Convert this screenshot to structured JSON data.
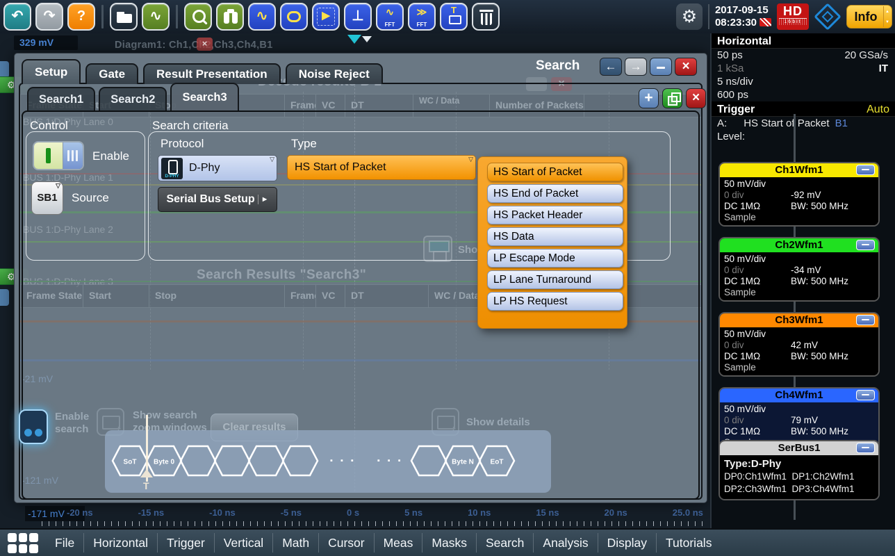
{
  "toolbar": {
    "icons": [
      {
        "name": "undo-icon",
        "cls": "c-teal",
        "glyph": "↶"
      },
      {
        "name": "redo-icon",
        "cls": "c-gray",
        "glyph": "↷"
      },
      {
        "name": "help-icon",
        "cls": "c-orange",
        "glyph": "?"
      },
      {
        "name": "toolbar-separator",
        "cls": "sep",
        "inter": false
      },
      {
        "name": "open-file-icon",
        "cls": "c-dark folder"
      },
      {
        "name": "signal-generator-icon",
        "cls": "c-green",
        "glyph": "∿"
      },
      {
        "name": "toolbar-separator",
        "cls": "sep",
        "inter": false
      },
      {
        "name": "zoom-icon",
        "cls": "c-green zoomsearch"
      },
      {
        "name": "find-binoculars-icon",
        "cls": "c-green binoculars"
      },
      {
        "name": "math-waveform-icon",
        "cls": "c-blue",
        "glyph": "∿",
        "fg": "#ffe14a"
      },
      {
        "name": "mask-test-icon",
        "cls": "c-blue masktest"
      },
      {
        "name": "reference-play-icon",
        "cls": "c-blue playmask",
        "glyph": "▶",
        "fg": "#ffe14a"
      },
      {
        "name": "measurement-caliper-icon",
        "cls": "c-blue",
        "glyph": "⊥",
        "fg": "#ffffff"
      },
      {
        "name": "fft-spectrum-icon",
        "cls": "c-blue fft",
        "glyph": "∿",
        "sub": "FFT",
        "fg": "#ffe14a"
      },
      {
        "name": "fft-gated-icon",
        "cls": "c-blue fft",
        "glyph": "≫",
        "sub": "FFT",
        "fg": "#ffe14a"
      },
      {
        "name": "timing-clamp-icon",
        "cls": "c-blue tclamp",
        "glyph": "T",
        "fg": "#ffe14a"
      },
      {
        "name": "delete-trash-icon",
        "cls": "c-dark trash"
      }
    ],
    "gear_glyph": "⚙",
    "date": "2017-09-15",
    "time": "08:23:30",
    "hd_badge": {
      "top": "HD",
      "bottom": "16bit"
    },
    "info_label": "Info"
  },
  "screen": {
    "corner_value": "329 mV",
    "diagram_tab": "Diagram1: Ch1,Ch2,Ch3,Ch4,B1",
    "close_glyph": "×",
    "tool_glyph": "⚙",
    "axis": {
      "left_label": "-171 mV",
      "ticks": [
        "-20 ns",
        "-15 ns",
        "-10 ns",
        "-5 ns",
        "0 s",
        "5 ns",
        "10 ns",
        "15 ns",
        "20 ns",
        "25.0 ns"
      ]
    }
  },
  "dialog": {
    "title": "Search",
    "window_buttons": {
      "back_glyph": "←",
      "forward_glyph": "→",
      "close_glyph": "×",
      "add_glyph": "+"
    },
    "tabs": [
      {
        "label": "Setup",
        "active": true
      },
      {
        "label": "Gate"
      },
      {
        "label": "Result Presentation"
      },
      {
        "label": "Noise Reject"
      }
    ],
    "search_tabs": [
      {
        "label": "Search1"
      },
      {
        "label": "Search2"
      },
      {
        "label": "Search3",
        "active": true
      }
    ],
    "control": {
      "heading": "Control",
      "enable_label": "Enable",
      "source_label": "Source",
      "source_value": "SB1"
    },
    "criteria": {
      "heading": "Search criteria",
      "protocol_label": "Protocol",
      "protocol_value": "D-Phy",
      "protocol_icon_text": "D-PHY",
      "serial_bus_label": "Serial Bus Setup",
      "serial_bus_arrow": "►",
      "type_label": "Type",
      "type_value": "HS Start of Packet"
    },
    "type_menu": [
      {
        "label": "HS Start of Packet",
        "active": true
      },
      {
        "label": "HS End of Packet"
      },
      {
        "label": "HS Packet Header"
      },
      {
        "label": "HS Data"
      },
      {
        "label": "LP Escape Mode"
      },
      {
        "label": "LP Lane Turnaround"
      },
      {
        "label": "LP HS Request"
      }
    ],
    "ghost": {
      "decode_title": "Decode results B 1",
      "decode_columns": [
        "Frame State",
        "Start",
        "Stop",
        "Frame Type",
        "VC",
        "DT",
        "WC / Data",
        "Number of Packets"
      ],
      "results_title": "Search Results \"Search3\"",
      "results_columns": [
        "Frame State",
        "Start",
        "Stop",
        "Frame Type",
        "VC",
        "DT",
        "WC / Data"
      ],
      "lane_labels": [
        "BUS 1:D-Phy Lane 0",
        "BUS 1:D-Phy Lane 1",
        "BUS 1:D-Phy Lane 2",
        "BUS 1:D-Phy Lane 3"
      ],
      "scale_labels": [
        "-21 mV",
        "-121 mV"
      ],
      "show_label": "Show"
    },
    "footer": {
      "enable_search": "Enable search",
      "show_zoom": "Show search zoom windows",
      "clear_results": "Clear results",
      "show_details": "Show details"
    },
    "packet_diagram": {
      "cells": [
        "SoT",
        "Byte 0",
        "",
        "",
        "",
        "",
        "...",
        "...",
        "",
        "Byte N",
        "EoT"
      ],
      "trigger_marker": "T"
    }
  },
  "sidebar": {
    "horizontal": {
      "title": "Horizontal",
      "r1l": "50 ps",
      "r1r": "20 GSa/s",
      "r2l": "1 kSa",
      "r2r": "IT",
      "r3l": "5 ns/div",
      "r4l": "600 ps"
    },
    "trigger": {
      "title": "Trigger",
      "mode": "Auto",
      "source_label": "A:",
      "source_value": "HS Start of Packet",
      "source_badge": "B1",
      "level_label": "Level:"
    },
    "channels": [
      {
        "name": "Ch1Wfm1",
        "color": "#f8e800",
        "body": "#000000",
        "scale": "50 mV/div",
        "pos": "0 div",
        "off": "-92 mV",
        "coup": "DC 1MΩ",
        "bw": "BW: 500 MHz",
        "mode": "Sample"
      },
      {
        "name": "Ch2Wfm1",
        "color": "#20e020",
        "body": "#000000",
        "scale": "50 mV/div",
        "pos": "0 div",
        "off": "-34 mV",
        "coup": "DC 1MΩ",
        "bw": "BW: 500 MHz",
        "mode": "Sample"
      },
      {
        "name": "Ch3Wfm1",
        "color": "#ff8800",
        "body": "#000000",
        "scale": "50 mV/div",
        "pos": "0 div",
        "off": "42 mV",
        "coup": "DC 1MΩ",
        "bw": "BW: 500 MHz",
        "mode": "Sample"
      },
      {
        "name": "Ch4Wfm1",
        "color": "#2a66ff",
        "body": "#0c1734",
        "scale": "50 mV/div",
        "pos": "0 div",
        "off": "79 mV",
        "coup": "DC 1MΩ",
        "bw": "BW: 500 MHz",
        "mode": "Sample"
      }
    ],
    "serbus": {
      "name": "SerBus1",
      "color": "#d2d2d2",
      "type": "Type:D-Phy",
      "line1": "DP0:Ch1Wfm1  DP1:Ch2Wfm1",
      "line2": "DP2:Ch3Wfm1  DP3:Ch4Wfm1"
    }
  },
  "menubar": {
    "items": [
      "File",
      "Horizontal",
      "Trigger",
      "Vertical",
      "Math",
      "Cursor",
      "Meas",
      "Masks",
      "Search",
      "Analysis",
      "Display",
      "Tutorials"
    ]
  }
}
